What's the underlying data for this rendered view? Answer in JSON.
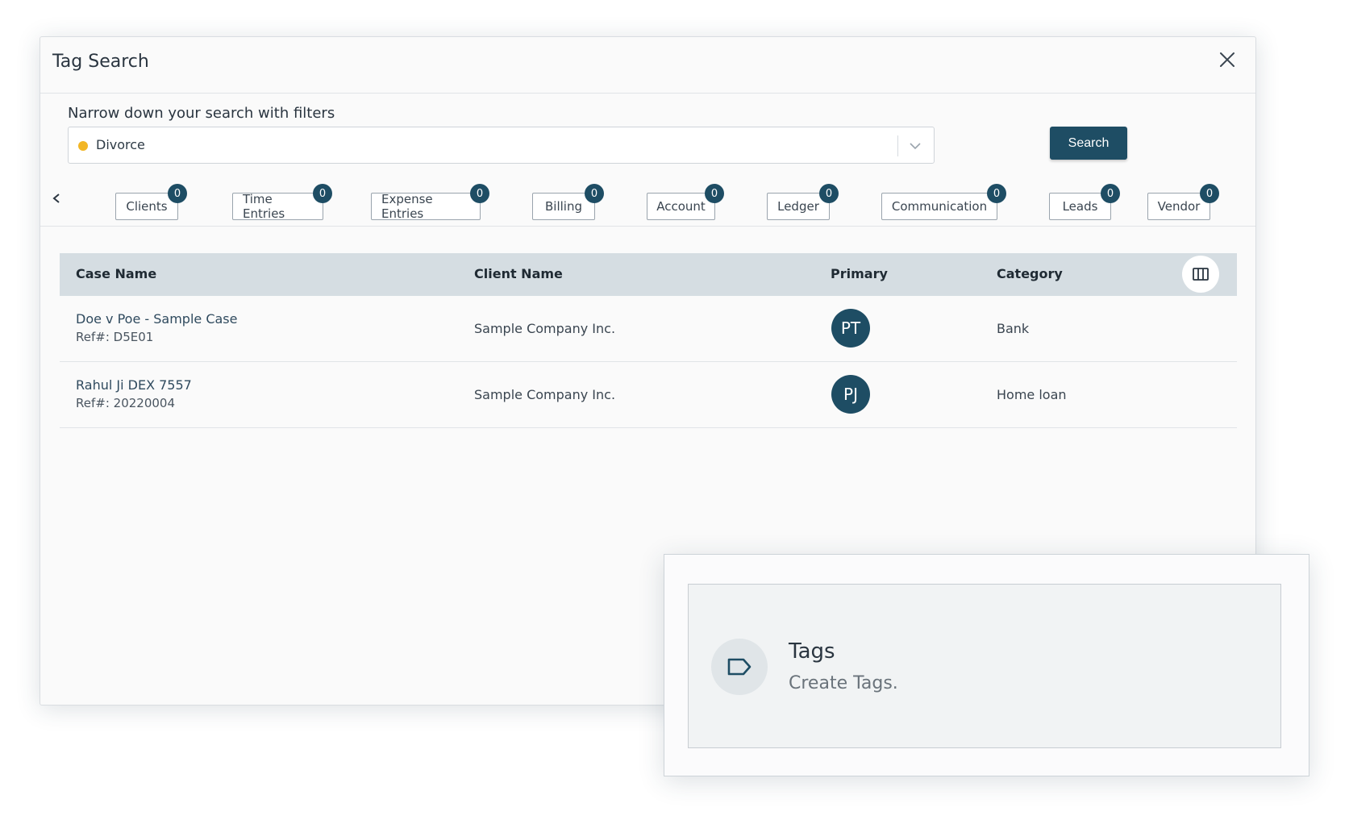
{
  "modal": {
    "title": "Tag Search",
    "close_label": "×"
  },
  "filter": {
    "label": "Narrow down your search with filters",
    "selected_tag": "Divorce",
    "tag_color": "#f2b625"
  },
  "search_button": "Search",
  "tabs": [
    {
      "label": "Clients",
      "count": "0"
    },
    {
      "label": "Time Entries",
      "count": "0"
    },
    {
      "label": "Expense Entries",
      "count": "0"
    },
    {
      "label": "Billing",
      "count": "0"
    },
    {
      "label": "Account",
      "count": "0"
    },
    {
      "label": "Ledger",
      "count": "0"
    },
    {
      "label": "Communication",
      "count": "0"
    },
    {
      "label": "Leads",
      "count": "0"
    },
    {
      "label": "Vendor",
      "count": "0"
    }
  ],
  "table": {
    "headers": {
      "case_name": "Case Name",
      "client_name": "Client Name",
      "primary": "Primary",
      "category": "Category"
    },
    "rows": [
      {
        "case_name": "Doe v Poe - Sample Case",
        "ref": "Ref#: D5E01",
        "client": "Sample Company Inc.",
        "primary": "PT",
        "category": "Bank"
      },
      {
        "case_name": "Rahul Ji DEX 7557",
        "ref": "Ref#: 20220004",
        "client": "Sample Company Inc.",
        "primary": "PJ",
        "category": "Home loan"
      }
    ]
  },
  "tags_card": {
    "title": "Tags",
    "subtitle": "Create Tags.",
    "icon": "tag-icon"
  },
  "colors": {
    "primary": "#1e4d64",
    "header_bg": "#d5dde2"
  }
}
